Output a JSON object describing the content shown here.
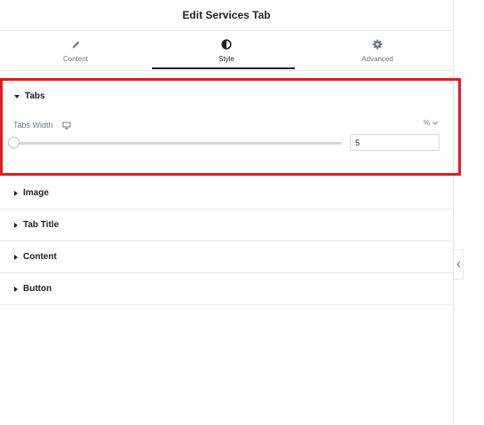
{
  "header": {
    "title": "Edit Services Tab"
  },
  "tabs": [
    {
      "label": "Content",
      "icon": "pencil-icon"
    },
    {
      "label": "Style",
      "icon": "half-circle-icon",
      "active": true
    },
    {
      "label": "Advanced",
      "icon": "gear-icon"
    }
  ],
  "tabs_section": {
    "label": "Tabs",
    "control": {
      "label": "Tabs Width",
      "device_icon": "desktop-icon",
      "unit": "%",
      "value": "5",
      "slider_fraction": 0.0
    }
  },
  "sections": [
    {
      "label": "Image"
    },
    {
      "label": "Tab Title"
    },
    {
      "label": "Content"
    },
    {
      "label": "Button"
    }
  ],
  "colors": {
    "highlight_border": "#e21b1b",
    "text": "#1f2124",
    "muted": "#6d7882"
  }
}
